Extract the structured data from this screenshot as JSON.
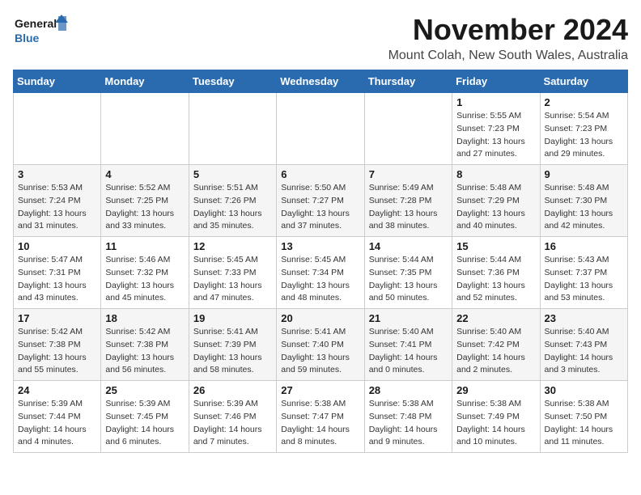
{
  "logo": {
    "text_general": "General",
    "text_blue": "Blue"
  },
  "header": {
    "month": "November 2024",
    "location": "Mount Colah, New South Wales, Australia"
  },
  "weekdays": [
    "Sunday",
    "Monday",
    "Tuesday",
    "Wednesday",
    "Thursday",
    "Friday",
    "Saturday"
  ],
  "weeks": [
    [
      {
        "day": "",
        "info": ""
      },
      {
        "day": "",
        "info": ""
      },
      {
        "day": "",
        "info": ""
      },
      {
        "day": "",
        "info": ""
      },
      {
        "day": "",
        "info": ""
      },
      {
        "day": "1",
        "info": "Sunrise: 5:55 AM\nSunset: 7:23 PM\nDaylight: 13 hours and 27 minutes."
      },
      {
        "day": "2",
        "info": "Sunrise: 5:54 AM\nSunset: 7:23 PM\nDaylight: 13 hours and 29 minutes."
      }
    ],
    [
      {
        "day": "3",
        "info": "Sunrise: 5:53 AM\nSunset: 7:24 PM\nDaylight: 13 hours and 31 minutes."
      },
      {
        "day": "4",
        "info": "Sunrise: 5:52 AM\nSunset: 7:25 PM\nDaylight: 13 hours and 33 minutes."
      },
      {
        "day": "5",
        "info": "Sunrise: 5:51 AM\nSunset: 7:26 PM\nDaylight: 13 hours and 35 minutes."
      },
      {
        "day": "6",
        "info": "Sunrise: 5:50 AM\nSunset: 7:27 PM\nDaylight: 13 hours and 37 minutes."
      },
      {
        "day": "7",
        "info": "Sunrise: 5:49 AM\nSunset: 7:28 PM\nDaylight: 13 hours and 38 minutes."
      },
      {
        "day": "8",
        "info": "Sunrise: 5:48 AM\nSunset: 7:29 PM\nDaylight: 13 hours and 40 minutes."
      },
      {
        "day": "9",
        "info": "Sunrise: 5:48 AM\nSunset: 7:30 PM\nDaylight: 13 hours and 42 minutes."
      }
    ],
    [
      {
        "day": "10",
        "info": "Sunrise: 5:47 AM\nSunset: 7:31 PM\nDaylight: 13 hours and 43 minutes."
      },
      {
        "day": "11",
        "info": "Sunrise: 5:46 AM\nSunset: 7:32 PM\nDaylight: 13 hours and 45 minutes."
      },
      {
        "day": "12",
        "info": "Sunrise: 5:45 AM\nSunset: 7:33 PM\nDaylight: 13 hours and 47 minutes."
      },
      {
        "day": "13",
        "info": "Sunrise: 5:45 AM\nSunset: 7:34 PM\nDaylight: 13 hours and 48 minutes."
      },
      {
        "day": "14",
        "info": "Sunrise: 5:44 AM\nSunset: 7:35 PM\nDaylight: 13 hours and 50 minutes."
      },
      {
        "day": "15",
        "info": "Sunrise: 5:44 AM\nSunset: 7:36 PM\nDaylight: 13 hours and 52 minutes."
      },
      {
        "day": "16",
        "info": "Sunrise: 5:43 AM\nSunset: 7:37 PM\nDaylight: 13 hours and 53 minutes."
      }
    ],
    [
      {
        "day": "17",
        "info": "Sunrise: 5:42 AM\nSunset: 7:38 PM\nDaylight: 13 hours and 55 minutes."
      },
      {
        "day": "18",
        "info": "Sunrise: 5:42 AM\nSunset: 7:38 PM\nDaylight: 13 hours and 56 minutes."
      },
      {
        "day": "19",
        "info": "Sunrise: 5:41 AM\nSunset: 7:39 PM\nDaylight: 13 hours and 58 minutes."
      },
      {
        "day": "20",
        "info": "Sunrise: 5:41 AM\nSunset: 7:40 PM\nDaylight: 13 hours and 59 minutes."
      },
      {
        "day": "21",
        "info": "Sunrise: 5:40 AM\nSunset: 7:41 PM\nDaylight: 14 hours and 0 minutes."
      },
      {
        "day": "22",
        "info": "Sunrise: 5:40 AM\nSunset: 7:42 PM\nDaylight: 14 hours and 2 minutes."
      },
      {
        "day": "23",
        "info": "Sunrise: 5:40 AM\nSunset: 7:43 PM\nDaylight: 14 hours and 3 minutes."
      }
    ],
    [
      {
        "day": "24",
        "info": "Sunrise: 5:39 AM\nSunset: 7:44 PM\nDaylight: 14 hours and 4 minutes."
      },
      {
        "day": "25",
        "info": "Sunrise: 5:39 AM\nSunset: 7:45 PM\nDaylight: 14 hours and 6 minutes."
      },
      {
        "day": "26",
        "info": "Sunrise: 5:39 AM\nSunset: 7:46 PM\nDaylight: 14 hours and 7 minutes."
      },
      {
        "day": "27",
        "info": "Sunrise: 5:38 AM\nSunset: 7:47 PM\nDaylight: 14 hours and 8 minutes."
      },
      {
        "day": "28",
        "info": "Sunrise: 5:38 AM\nSunset: 7:48 PM\nDaylight: 14 hours and 9 minutes."
      },
      {
        "day": "29",
        "info": "Sunrise: 5:38 AM\nSunset: 7:49 PM\nDaylight: 14 hours and 10 minutes."
      },
      {
        "day": "30",
        "info": "Sunrise: 5:38 AM\nSunset: 7:50 PM\nDaylight: 14 hours and 11 minutes."
      }
    ]
  ]
}
